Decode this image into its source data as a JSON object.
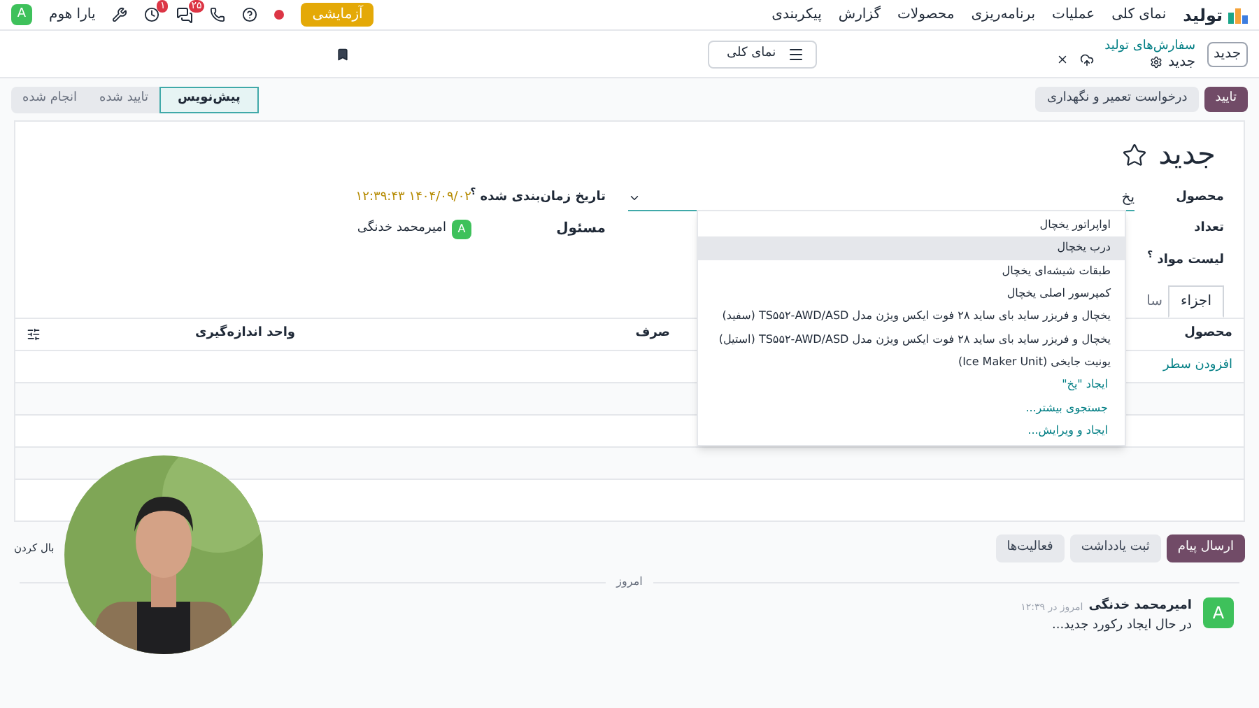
{
  "app_bar": {
    "app_name": "تولید",
    "menu": [
      "نمای کلی",
      "عملیات",
      "برنامه‌ریزی",
      "محصولات",
      "گزارش",
      "پیکربندی"
    ],
    "trial_badge": "آزمایشی",
    "chat_count": "۲۵",
    "activity_count": "۱",
    "company": "یارا هوم",
    "user_initial": "A"
  },
  "control_panel": {
    "new_button": "جدید",
    "breadcrumb": "سفارش‌های تولید",
    "record": "جدید",
    "view_button": "نمای کلی"
  },
  "actions": [
    {
      "label": "تایید",
      "kind": "primary"
    },
    {
      "label": "درخواست تعمیر و نگهداری",
      "kind": "secondary"
    }
  ],
  "status_steps": [
    {
      "label": "پیش‌نویس",
      "selected": true
    },
    {
      "label": "تایید شده",
      "selected": false
    },
    {
      "label": "انجام شده",
      "selected": false
    }
  ],
  "form": {
    "title": "جدید",
    "starred": false,
    "product": {
      "label": "محصول",
      "value": "یخ"
    },
    "quantity": {
      "label": "تعداد"
    },
    "bom": {
      "label": "لیست مواد",
      "help": "؟"
    },
    "scheduled_date": {
      "label": "تاریخ زمان‌بندی شده",
      "help": "؟",
      "value": "۱۴۰۴/۰۹/۰۲ ۱۲:۳۹:۴۳"
    },
    "responsible": {
      "label": "مسئول",
      "initial": "A",
      "name": "امیرمحمد خدنگی"
    },
    "tabs": [
      {
        "label": "اجزاء",
        "selected": true
      },
      {
        "label": "سا",
        "selected": false
      }
    ],
    "table": {
      "columns": [
        "محصول",
        "صرف",
        "واحد اندازه‌گیری"
      ],
      "add_line": "افزودن سطر"
    }
  },
  "dropdown": [
    {
      "label": "اواپراتور یخچال",
      "kind": "option",
      "selected": false
    },
    {
      "label": "درب یخچال",
      "kind": "option",
      "selected": true
    },
    {
      "label": "طبقات شیشه‌ای یخچال",
      "kind": "option",
      "selected": false
    },
    {
      "label": "کمپرسور اصلی یخچال",
      "kind": "option",
      "selected": false
    },
    {
      "label": "یخچال و فریزر ساید بای ساید ۲۸ فوت ایکس ویژن مدل TS۵۵۲-AWD/ASD (سفید)",
      "kind": "option",
      "selected": false
    },
    {
      "label": "یخچال و فریزر ساید بای ساید ۲۸ فوت ایکس ویژن مدل TS۵۵۲-AWD/ASD (استیل)",
      "kind": "option",
      "selected": false
    },
    {
      "label": "یونیت جایخی (Ice Maker Unit)",
      "kind": "option",
      "selected": false
    },
    {
      "label": "ایجاد \"یخ\"",
      "kind": "action",
      "selected": false
    },
    {
      "label": "جستجوی بیشتر...",
      "kind": "action",
      "selected": false
    },
    {
      "label": "ایجاد و ویرایش...",
      "kind": "action",
      "selected": false
    }
  ],
  "chatter": {
    "buttons": [
      {
        "label": "ارسال پیام",
        "kind": "primary"
      },
      {
        "label": "ثبت یادداشت",
        "kind": "secondary"
      },
      {
        "label": "فعالیت‌ها",
        "kind": "secondary"
      }
    ],
    "follow": "بال کردن",
    "divider": "امروز",
    "messages": [
      {
        "initial": "A",
        "author": "امیرمحمد خدنگی",
        "time": "امروز در ۱۲:۳۹",
        "body": "در حال ایجاد رکورد جدید..."
      }
    ]
  }
}
